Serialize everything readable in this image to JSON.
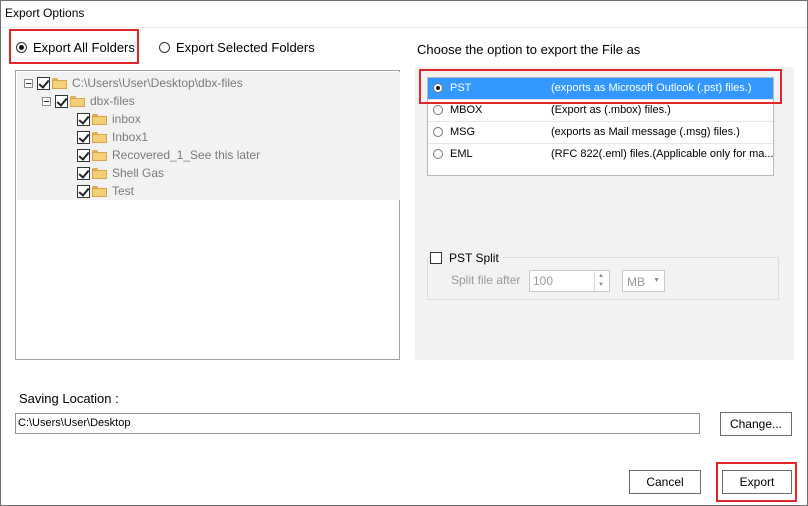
{
  "window": {
    "title": "Export Options"
  },
  "scope": {
    "all_label": "Export All Folders",
    "selected_label": "Export Selected Folders",
    "selected": "all"
  },
  "tree": {
    "root": "C:\\Users\\User\\Desktop\\dbx-files",
    "folder": "dbx-files",
    "children": [
      "inbox",
      "Inbox1",
      "Recovered_1_See this later",
      "Shell Gas",
      "Test"
    ]
  },
  "format": {
    "heading": "Choose the option to export the File as",
    "selected": "PST",
    "options": [
      {
        "name": "PST",
        "desc": "(exports as Microsoft Outlook (.pst) files.)"
      },
      {
        "name": "MBOX",
        "desc": "(Export as (.mbox) files.)"
      },
      {
        "name": "MSG",
        "desc": "(exports as Mail message (.msg) files.)"
      },
      {
        "name": "EML",
        "desc": "(RFC 822(.eml) files.(Applicable only for ma..."
      }
    ]
  },
  "split": {
    "label": "PST Split",
    "checked": false,
    "after_label": "Split file after",
    "size": "100",
    "unit": "MB"
  },
  "saving": {
    "label": "Saving Location :",
    "path": "C:\\Users\\User\\Desktop",
    "change_label": "Change..."
  },
  "actions": {
    "cancel_label": "Cancel",
    "export_label": "Export"
  },
  "colors": {
    "highlight": "#e0252b",
    "selection": "#3399ff"
  }
}
